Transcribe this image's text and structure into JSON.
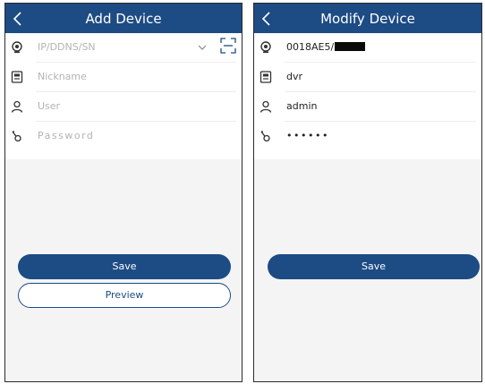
{
  "add_screen": {
    "title": "Add Device",
    "fields": {
      "address_placeholder": "IP/DDNS/SN",
      "nickname_placeholder": "Nickname",
      "user_placeholder": "User",
      "password_placeholder": "Password"
    },
    "save_label": "Save",
    "preview_label": "Preview"
  },
  "modify_screen": {
    "title": "Modify Device",
    "fields": {
      "address_value": "0018AE5/",
      "nickname_value": "dvr",
      "user_value": "admin",
      "password_value": "••••••"
    },
    "save_label": "Save"
  },
  "icons": {
    "back": "chevron-left-icon",
    "address": "camera-icon",
    "nickname": "device-card-icon",
    "user": "person-icon",
    "password": "key-icon",
    "dropdown": "chevron-down-icon",
    "scan": "qr-scan-icon"
  },
  "colors": {
    "brand": "#1d4b84",
    "placeholder": "#b3b3b3",
    "page_background": "#f4f4f5"
  }
}
